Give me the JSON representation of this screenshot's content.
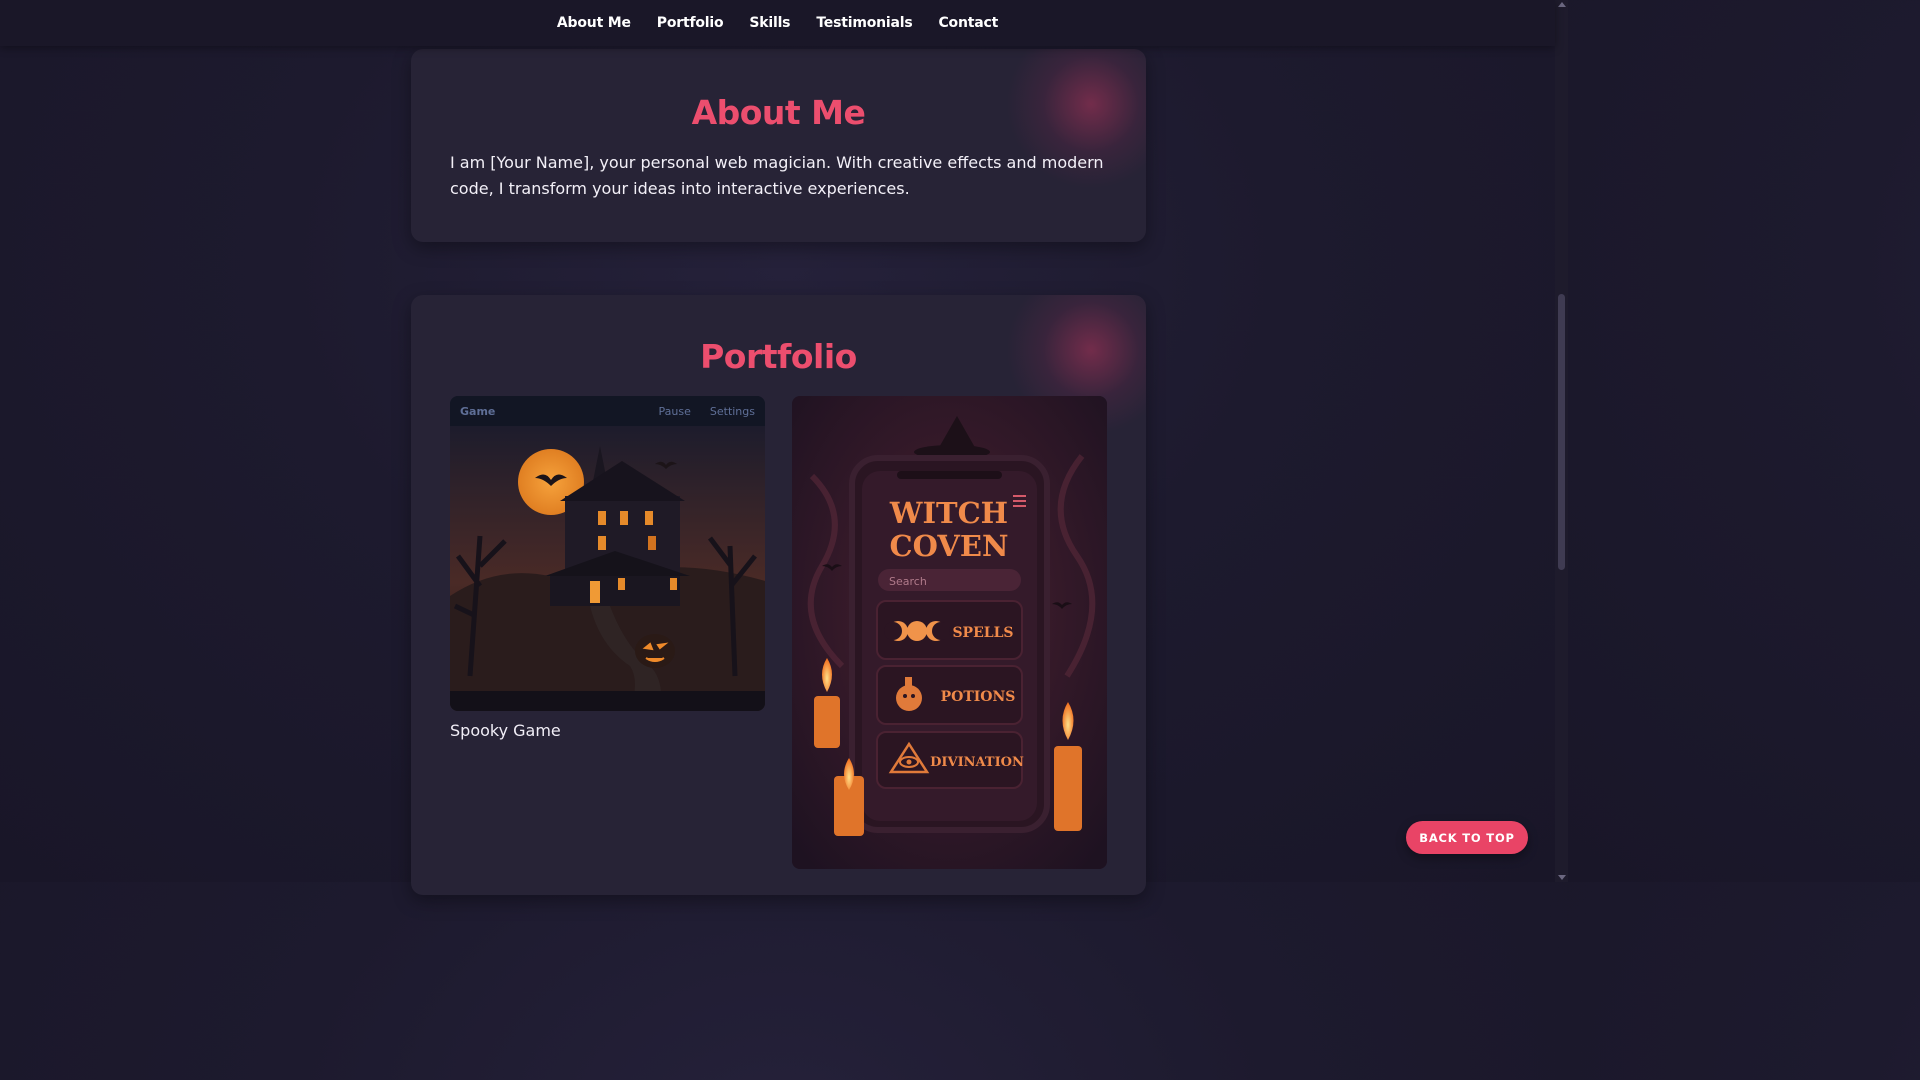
{
  "nav": {
    "items": [
      "About Me",
      "Portfolio",
      "Skills",
      "Testimonials",
      "Contact"
    ]
  },
  "about": {
    "title": "About Me",
    "text": "I am [Your Name], your personal web magician. With creative effects and modern code, I transform your ideas into interactive experiences."
  },
  "portfolio": {
    "title": "Portfolio",
    "items": [
      {
        "caption": "Spooky Game",
        "game_bar": {
          "title": "Game",
          "pause": "Pause",
          "settings": "Settings"
        }
      },
      {
        "app": {
          "title_line1": "WITCH",
          "title_line2": "COVEN",
          "search_placeholder": "Search",
          "menu": [
            "SPELLS",
            "POTIONS",
            "DIVINATION"
          ]
        }
      }
    ]
  },
  "back_to_top": "BACK TO TOP",
  "colors": {
    "accent": "#ec4e6e",
    "page_bg": "#1d1a2e",
    "card_bg": "#272336",
    "nav_bg": "#1a1728",
    "button_bg": "#e94466"
  }
}
